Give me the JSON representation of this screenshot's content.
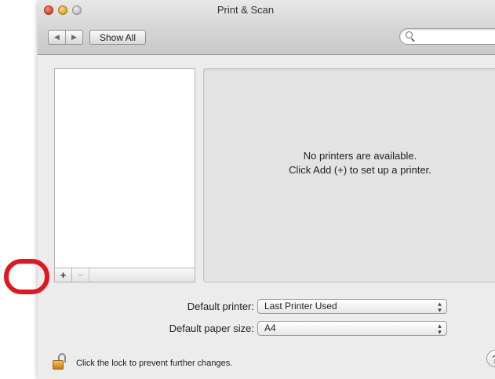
{
  "window": {
    "title": "Print & Scan"
  },
  "toolbar": {
    "back_icon": "◀",
    "forward_icon": "▶",
    "show_all_label": "Show All",
    "search": {
      "value": "",
      "placeholder": ""
    }
  },
  "printer_list": {
    "add_label": "+",
    "remove_label": "−"
  },
  "detail": {
    "line1": "No printers are available.",
    "line2": "Click Add (+) to set up a printer."
  },
  "settings": {
    "default_printer_label": "Default printer:",
    "default_printer_value": "Last Printer Used",
    "paper_size_label": "Default paper size:",
    "paper_size_value": "A4"
  },
  "footer": {
    "lock_text": "Click the lock to prevent further changes.",
    "help_label": "?"
  },
  "colors": {
    "highlight": "#e3161e",
    "window_bg": "#ececec"
  }
}
